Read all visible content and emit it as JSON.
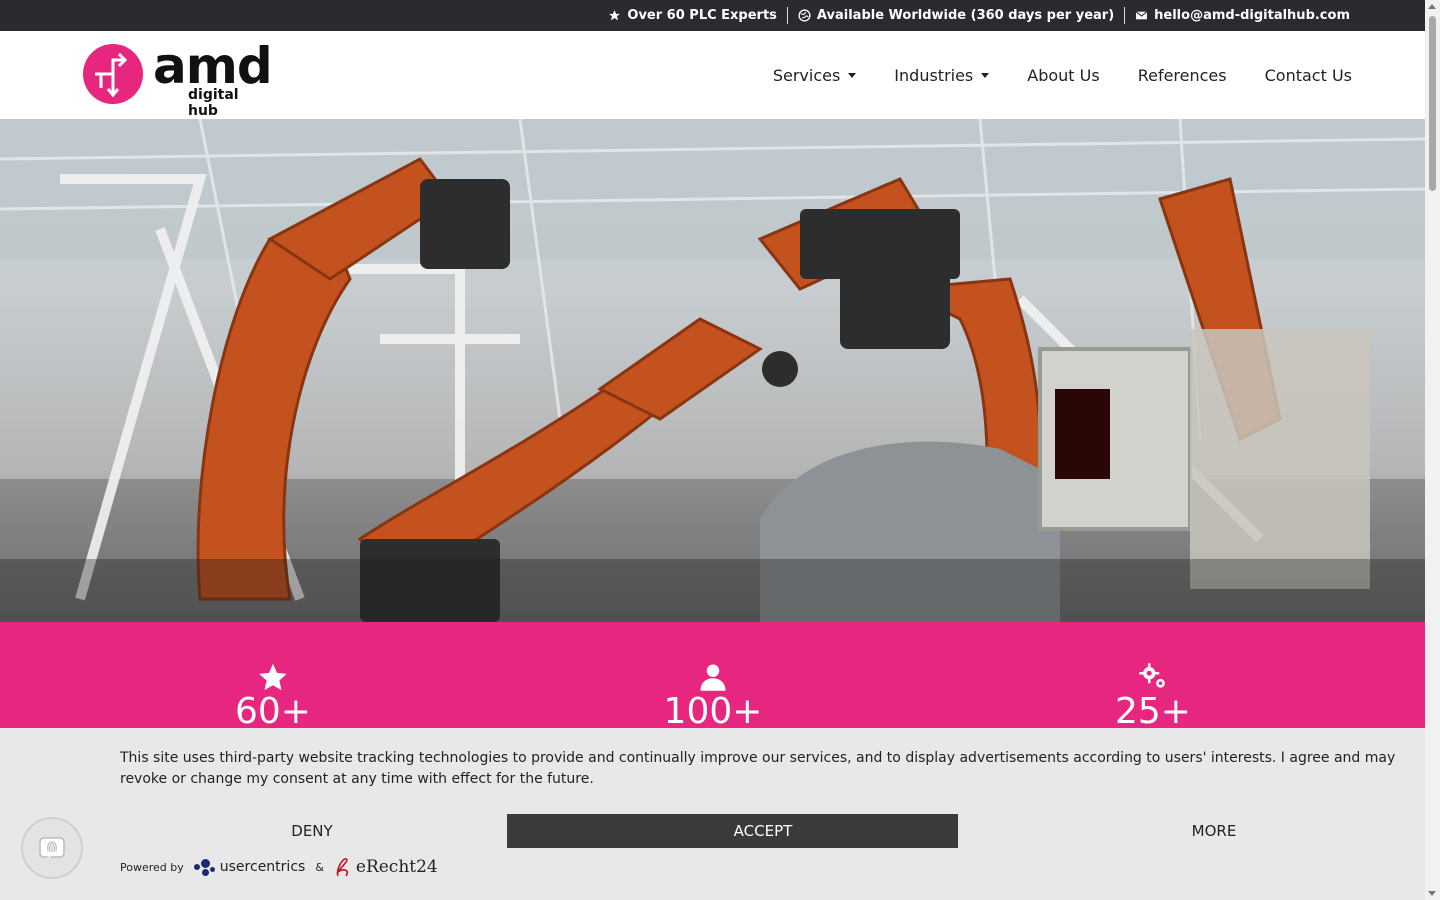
{
  "topbar": {
    "items": [
      {
        "icon": "star-icon",
        "label": "Over 60 PLC Experts"
      },
      {
        "icon": "globe-icon",
        "label": "Available Worldwide (360 days per year)"
      },
      {
        "icon": "mail-icon",
        "label": "hello@amd-digitalhub.com"
      }
    ]
  },
  "logo": {
    "main": "amd",
    "sub": "digital hub",
    "color": "#e6267f"
  },
  "nav": {
    "items": [
      {
        "label": "Services",
        "dropdown": true
      },
      {
        "label": "Industries",
        "dropdown": true
      },
      {
        "label": "About Us",
        "dropdown": false
      },
      {
        "label": "References",
        "dropdown": false
      },
      {
        "label": "Contact Us",
        "dropdown": false
      }
    ]
  },
  "hero": {
    "image": "industrial-robots-photo"
  },
  "stats": {
    "color": "#e6267f",
    "items": [
      {
        "icon": "star-icon",
        "value": "60+"
      },
      {
        "icon": "user-icon",
        "value": "100+"
      },
      {
        "icon": "gears-icon",
        "value": "25+"
      }
    ]
  },
  "cookie": {
    "text": "This site uses third-party website tracking technologies to provide and continually improve our services, and to display advertisements according to users' interests. I agree and may revoke or change my consent at any time with effect for the future.",
    "deny": "DENY",
    "accept": "ACCEPT",
    "more": "MORE",
    "powered_by": "Powered by",
    "usercentrics": "usercentrics",
    "amp": "&",
    "erecht": "eRecht24"
  }
}
